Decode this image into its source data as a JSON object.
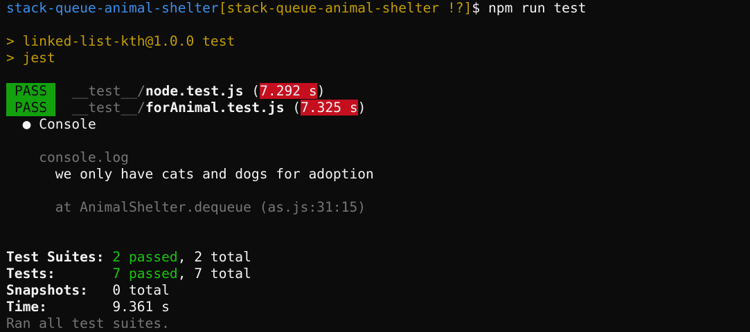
{
  "prompt": {
    "cwd_name": "stack-queue-animal-shelter",
    "branch": "[stack-queue-animal-shelter !?]",
    "symbol": "$",
    "command": "npm run test"
  },
  "npm_output": {
    "line1": "> linked-list-kth@1.0.0 test",
    "line2": "> jest"
  },
  "tests": [
    {
      "status": "PASS",
      "dir": "__test__/",
      "file": "node.test.js",
      "open": " (",
      "time": "7.292 s",
      "close": ")"
    },
    {
      "status": "PASS",
      "dir": "__test__/",
      "file": "forAnimal.test.js",
      "open": " (",
      "time": "7.325 s",
      "close": ")"
    }
  ],
  "console": {
    "bullet": "●",
    "title": "Console",
    "log_label": "console.log",
    "message": "we only have cats and dogs for adoption",
    "stack": "at AnimalShelter.dequeue (as.js:31:15)"
  },
  "summary": {
    "suites_label": "Test Suites:",
    "suites_passed": "2 passed",
    "suites_total": ", 2 total",
    "tests_label": "Tests:",
    "tests_passed": "7 passed",
    "tests_total": ", 7 total",
    "snapshots_label": "Snapshots:",
    "snapshots_value": "0 total",
    "time_label": "Time:",
    "time_value": "9.361 s",
    "footer": "Ran all test suites."
  },
  "colors": {
    "background": "#0c0c0c",
    "prompt_path": "#3b8eea",
    "prompt_branch": "#c19c00",
    "pass_badge": "#13a10e",
    "time_badge": "#c50f1f",
    "passed_text": "#16c60c",
    "dim_text": "#767676"
  }
}
